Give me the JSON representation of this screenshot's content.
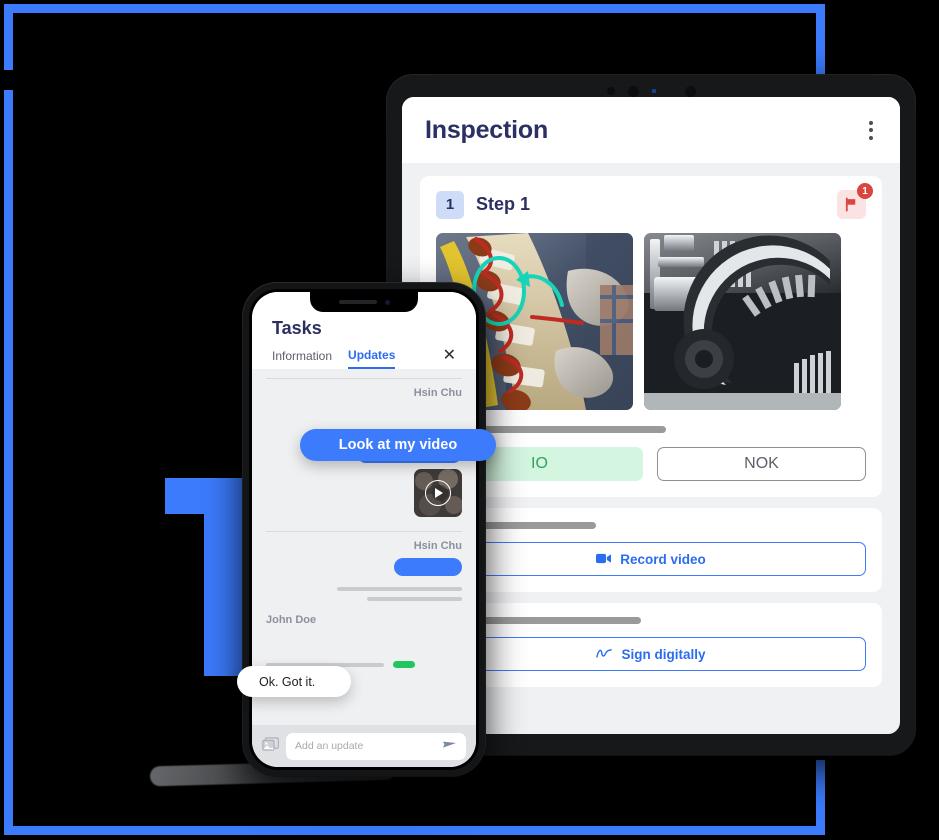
{
  "brand": {
    "accent_blue": "#3b7bfc",
    "navy": "#2b2f63",
    "green": "#31a35d",
    "red": "#d9453f"
  },
  "decoration": {
    "letter_glyph": "T",
    "frame_color": "#3b7bfc",
    "background_color": "#000000"
  },
  "tablet": {
    "header": {
      "title": "Inspection",
      "menu_icon": "kebab-menu-icon"
    },
    "step_card": {
      "number": "1",
      "title": "Step 1",
      "flag_icon": "flag-icon",
      "flag_badge_count": "1",
      "photos": [
        {
          "name": "stator-coil-winding-photo",
          "annotation": "teal-circle-arrow"
        },
        {
          "name": "gearbox-machinery-photo",
          "annotation": "none"
        }
      ],
      "choices": [
        {
          "label": "IO",
          "state": "selected",
          "color": "#31a35d",
          "bg": "#d4f5e0"
        },
        {
          "label": "NOK",
          "state": "unselected",
          "color": "#5b6069"
        }
      ]
    },
    "record_card": {
      "button_label": "Record video",
      "icon": "video-camera-icon"
    },
    "sign_card": {
      "button_label": "Sign digitally",
      "icon": "signature-icon"
    }
  },
  "phone": {
    "title": "Tasks",
    "tabs": [
      {
        "label": "Information",
        "active": false
      },
      {
        "label": "Updates",
        "active": true
      }
    ],
    "close_icon": "close-icon",
    "messages": [
      {
        "sender": "Hsin Chu",
        "side": "right",
        "text": "Look at my video",
        "kind": "bubble"
      },
      {
        "sender": "",
        "side": "right",
        "text": "",
        "kind": "placeholder"
      },
      {
        "sender": "",
        "side": "right",
        "text": "",
        "kind": "video-thumbnail"
      },
      {
        "sender": "Hsin Chu",
        "side": "right",
        "text": "",
        "kind": "placeholder"
      },
      {
        "sender": "John Doe",
        "side": "left",
        "text": "Ok. Got it.",
        "kind": "bubble"
      }
    ],
    "composer": {
      "placeholder": "Add an update",
      "attach_icon": "image-icon",
      "send_icon": "send-icon"
    }
  }
}
